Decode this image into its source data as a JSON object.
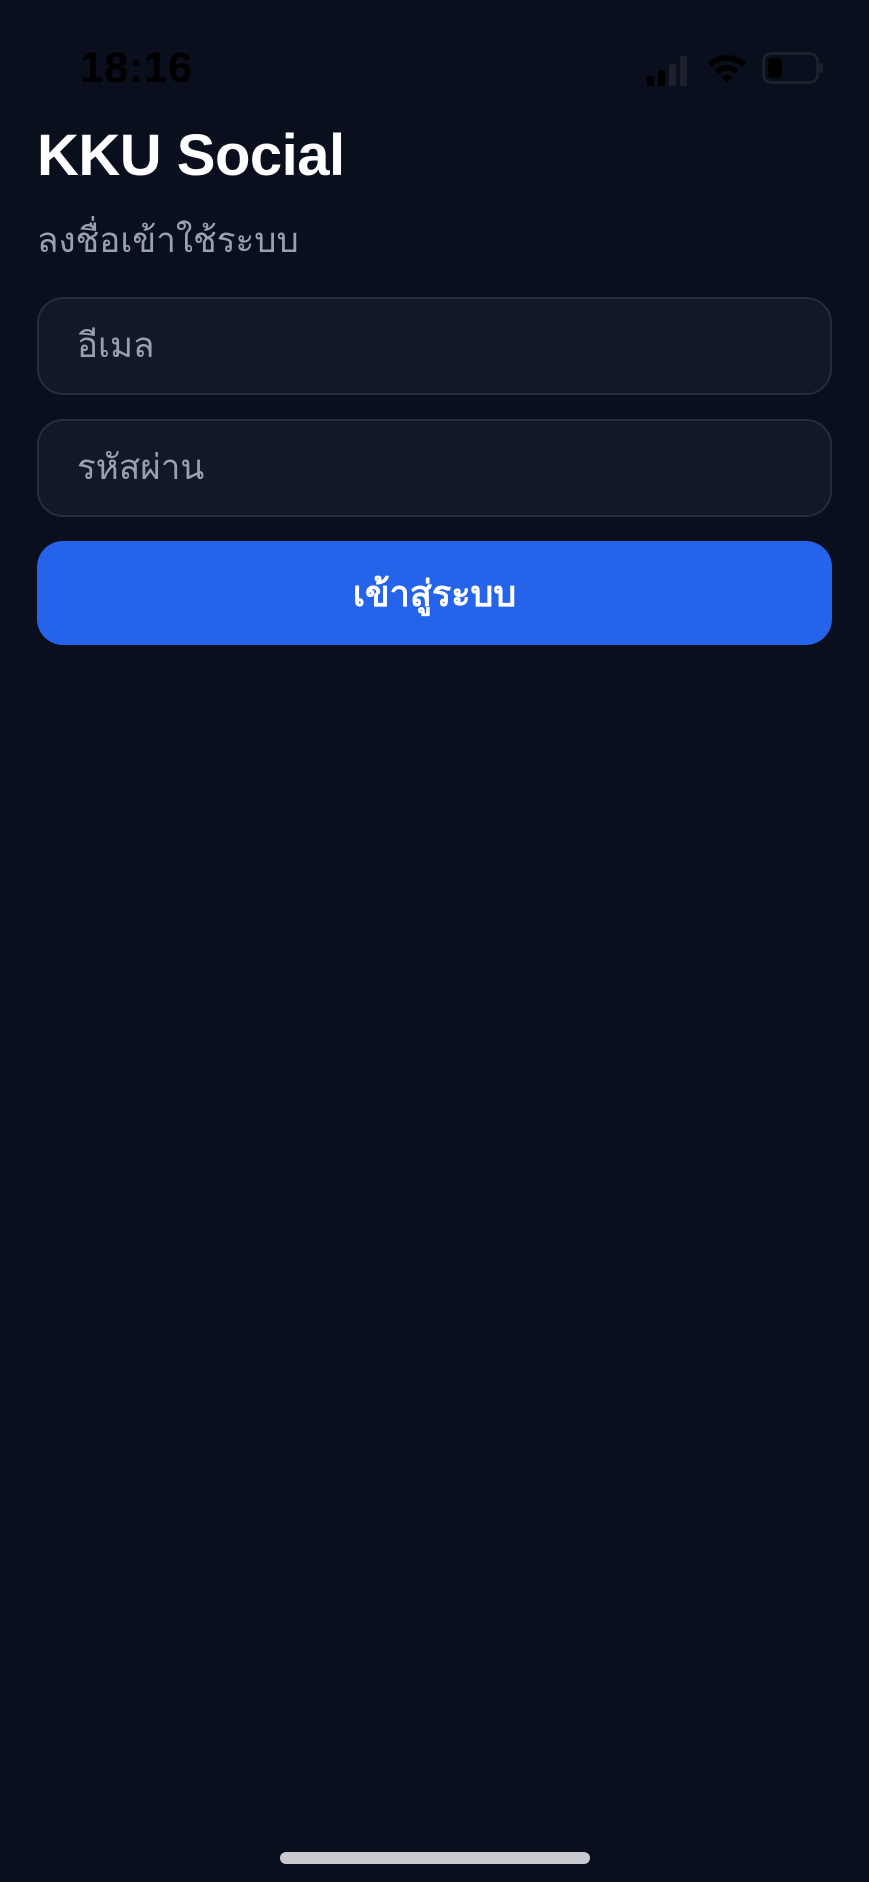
{
  "status_bar": {
    "time": "18:16",
    "signal_icon": "cellular-signal-icon",
    "wifi_icon": "wifi-icon",
    "battery_icon": "battery-icon",
    "battery_level": 0.3
  },
  "header": {
    "title": "KKU Social",
    "subtitle": "ลงชื่อเข้าใช้ระบบ"
  },
  "form": {
    "email": {
      "value": "",
      "placeholder": "อีเมล"
    },
    "password": {
      "value": "",
      "placeholder": "รหัสผ่าน"
    },
    "submit_label": "เข้าสู่ระบบ"
  },
  "colors": {
    "background": "#0a0f1e",
    "field_background": "#121827",
    "field_border": "#252c3c",
    "accent": "#2563eb",
    "subtitle_text": "#9aa1ae"
  }
}
